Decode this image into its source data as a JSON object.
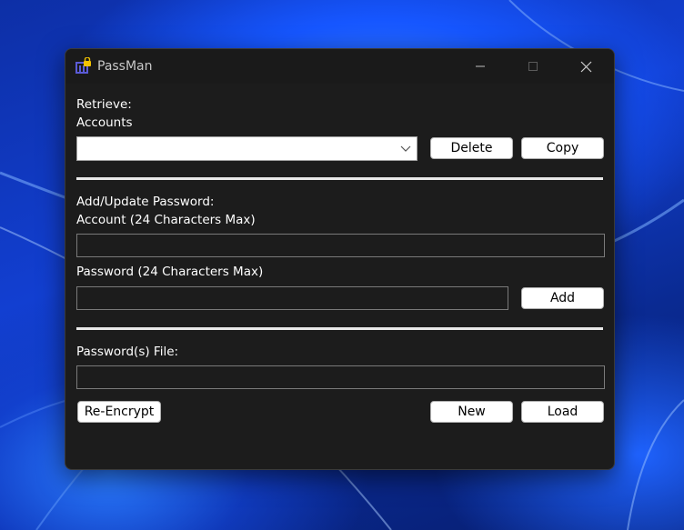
{
  "window": {
    "title": "PassMan"
  },
  "retrieve": {
    "heading": "Retrieve:",
    "accounts_label": "Accounts",
    "accounts_selected": "",
    "delete_label": "Delete",
    "copy_label": "Copy"
  },
  "add_update": {
    "heading": "Add/Update Password:",
    "account_label": "Account (24 Characters Max)",
    "account_value": "",
    "password_label": "Password (24 Characters Max)",
    "password_value": "",
    "add_label": "Add"
  },
  "file": {
    "label": "Password(s) File:",
    "path_value": "",
    "reencrypt_label": "Re-Encrypt",
    "new_label": "New",
    "load_label": "Load"
  },
  "colors": {
    "window_bg": "#1c1c1c",
    "button_bg": "#ffffff",
    "separator": "#e8e8e8",
    "app_icon_lock": "#f2c200",
    "app_icon_body": "#5b5bd6"
  },
  "icons": {
    "app": "lock-database-icon",
    "minimize": "minimize-icon",
    "maximize": "maximize-icon",
    "close": "close-icon",
    "dropdown": "chevron-down-icon"
  }
}
